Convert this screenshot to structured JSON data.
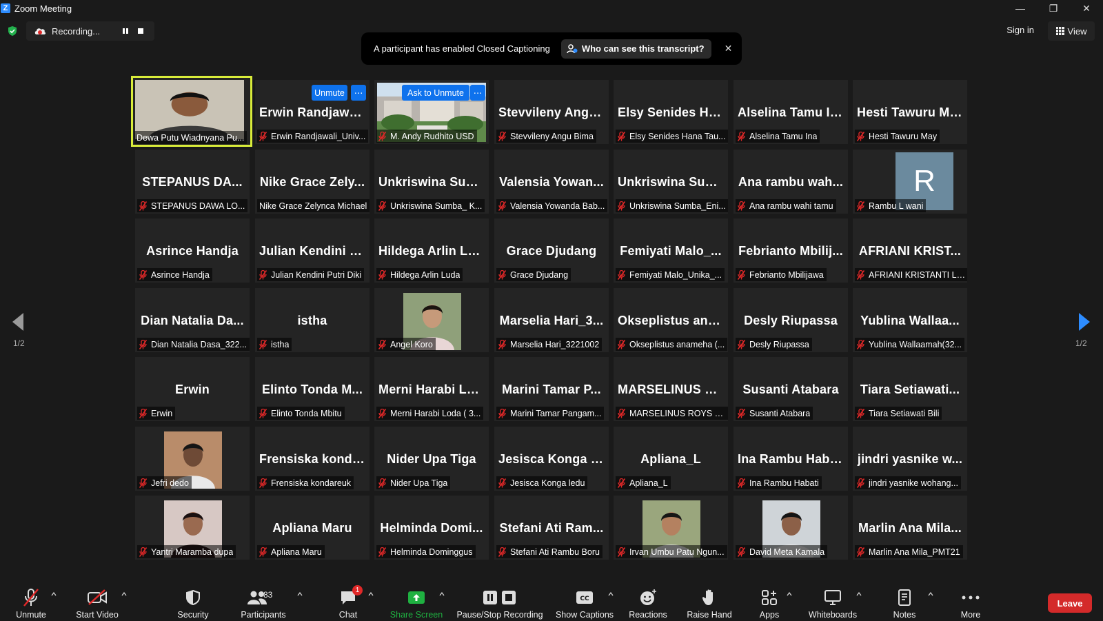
{
  "window": {
    "title": "Zoom Meeting"
  },
  "topbar": {
    "recording_label": "Recording...",
    "sign_in": "Sign in",
    "view": "View"
  },
  "banner": {
    "message": "A participant has enabled Closed Captioning",
    "button": "Who can see this transcript?"
  },
  "hover": {
    "unmute": "Unmute",
    "ask_to_unmute": "Ask to Unmute"
  },
  "pager": {
    "left": "1/2",
    "right": "1/2"
  },
  "tiles": [
    {
      "big": "",
      "name": "Dewa Putu Wiadnyana Pu...",
      "photo": "photo-dewa",
      "muted": false,
      "active": true
    },
    {
      "big": "Erwin Randjawa...",
      "name": "Erwin Randjawali_Univ...",
      "muted": true
    },
    {
      "big": "",
      "name": "M. Andy Rudhito USD",
      "photo": "photo-andy",
      "muted": true
    },
    {
      "big": "Stevvileny Angu...",
      "name": "Stevvileny Angu Bima",
      "muted": true
    },
    {
      "big": "Elsy Senides Ha...",
      "name": "Elsy Senides Hana Tau...",
      "muted": true
    },
    {
      "big": "Alselina Tamu Ina",
      "name": "Alselina Tamu Ina",
      "muted": true
    },
    {
      "big": "Hesti Tawuru May",
      "name": "Hesti Tawuru May",
      "muted": true
    },
    {
      "big": "STEPANUS DA...",
      "name": "STEPANUS DAWA LO...",
      "muted": true
    },
    {
      "big": "Nike Grace Zely...",
      "name": "Nike Grace Zelynca Michael",
      "muted": false
    },
    {
      "big": "Unkriswina Sum...",
      "name": "Unkriswina Sumba_ K...",
      "muted": true
    },
    {
      "big": "Valensia Yowan...",
      "name": "Valensia Yowanda Bab...",
      "muted": true
    },
    {
      "big": "Unkriswina Sum...",
      "name": "Unkriswina Sumba_Eni...",
      "muted": true
    },
    {
      "big": "Ana rambu wah...",
      "name": "Ana rambu wahi tamu",
      "muted": true
    },
    {
      "big": "",
      "avatar": "R",
      "name": "Rambu L wani",
      "muted": true
    },
    {
      "big": "Asrince Handja",
      "name": "Asrince Handja",
      "muted": true
    },
    {
      "big": "Julian Kendini P...",
      "name": "Julian Kendini Putri Diki",
      "muted": true
    },
    {
      "big": "Hildega Arlin Lu...",
      "name": "Hildega Arlin Luda",
      "muted": true
    },
    {
      "big": "Grace Djudang",
      "name": "Grace Djudang",
      "muted": true
    },
    {
      "big": "Femiyati Malo_...",
      "name": "Femiyati Malo_Unika_...",
      "muted": true
    },
    {
      "big": "Febrianto Mbilij...",
      "name": "Febrianto Mbilijawa",
      "muted": true
    },
    {
      "big": "AFRIANI KRIST...",
      "name": "AFRIANI KRISTANTI LA...",
      "muted": true
    },
    {
      "big": "Dian Natalia Da...",
      "name": "Dian Natalia Dasa_322...",
      "muted": true
    },
    {
      "big": "istha",
      "name": "istha",
      "muted": true
    },
    {
      "big": "",
      "name": "Angel Koro",
      "photo": "photo-angel",
      "muted": true
    },
    {
      "big": "Marselia Hari_3...",
      "name": "Marselia Hari_3221002",
      "muted": true
    },
    {
      "big": "Okseplistus ana...",
      "name": "Okseplistus anameha (...",
      "muted": true
    },
    {
      "big": "Desly Riupassa",
      "name": "Desly Riupassa",
      "muted": true
    },
    {
      "big": "Yublina Wallaa...",
      "name": "Yublina Wallaamah(32...",
      "muted": true
    },
    {
      "big": "Erwin",
      "name": "Erwin",
      "muted": true
    },
    {
      "big": "Elinto Tonda M...",
      "name": "Elinto Tonda Mbitu",
      "muted": true
    },
    {
      "big": "Merni Harabi Lo...",
      "name": "Merni Harabi Loda ( 3...",
      "muted": true
    },
    {
      "big": "Marini Tamar P...",
      "name": "Marini Tamar Pangam...",
      "muted": true
    },
    {
      "big": "MARSELINUS R...",
      "name": "MARSELINUS ROYS B...",
      "muted": true
    },
    {
      "big": "Susanti Atabara",
      "name": "Susanti Atabara",
      "muted": true
    },
    {
      "big": "Tiara Setiawati...",
      "name": "Tiara Setiawati Bili",
      "muted": true
    },
    {
      "big": "",
      "name": "Jefri dedo",
      "photo": "photo-jefri",
      "muted": true
    },
    {
      "big": "Frensiska konda...",
      "name": "Frensiska kondareuk",
      "muted": true
    },
    {
      "big": "Nider Upa Tiga",
      "name": "Nider Upa Tiga",
      "muted": true
    },
    {
      "big": "Jesisca Konga le...",
      "name": "Jesisca Konga ledu",
      "muted": true
    },
    {
      "big": "Apliana_L",
      "name": "Apliana_L",
      "muted": true
    },
    {
      "big": "Ina Rambu Habati",
      "name": "Ina Rambu Habati",
      "muted": true
    },
    {
      "big": "jindri yasnike w...",
      "name": "jindri yasnike wohang...",
      "muted": true
    },
    {
      "big": "",
      "name": "Yantri Maramba dupa",
      "photo": "photo-yantri",
      "muted": true
    },
    {
      "big": "Apliana Maru",
      "name": "Apliana Maru",
      "muted": true
    },
    {
      "big": "Helminda Domi...",
      "name": "Helminda Dominggus",
      "muted": true
    },
    {
      "big": "Stefani Ati Ram...",
      "name": "Stefani Ati Rambu Boru",
      "muted": true
    },
    {
      "big": "",
      "name": "Irvan Umbu Patu Ngun...",
      "photo": "photo-irvan",
      "muted": true
    },
    {
      "big": "",
      "name": "David Meta Kamala",
      "photo": "photo-david",
      "muted": true
    },
    {
      "big": "Marlin Ana Mila...",
      "name": "Marlin Ana Mila_PMT21",
      "muted": true
    }
  ],
  "toolbar": {
    "unmute": "Unmute",
    "start_video": "Start Video",
    "security": "Security",
    "participants": "Participants",
    "participants_count": "83",
    "chat": "Chat",
    "chat_badge": "1",
    "share_screen": "Share Screen",
    "pause_stop_recording": "Pause/Stop Recording",
    "show_captions": "Show Captions",
    "reactions": "Reactions",
    "raise_hand": "Raise Hand",
    "apps": "Apps",
    "whiteboards": "Whiteboards",
    "notes": "Notes",
    "more": "More",
    "leave": "Leave"
  },
  "colors": {
    "accent": "#0e72ed",
    "active_speaker": "#d9ec3a",
    "leave": "#d42a2a",
    "share": "#1fb141",
    "muted": "#e02828"
  }
}
